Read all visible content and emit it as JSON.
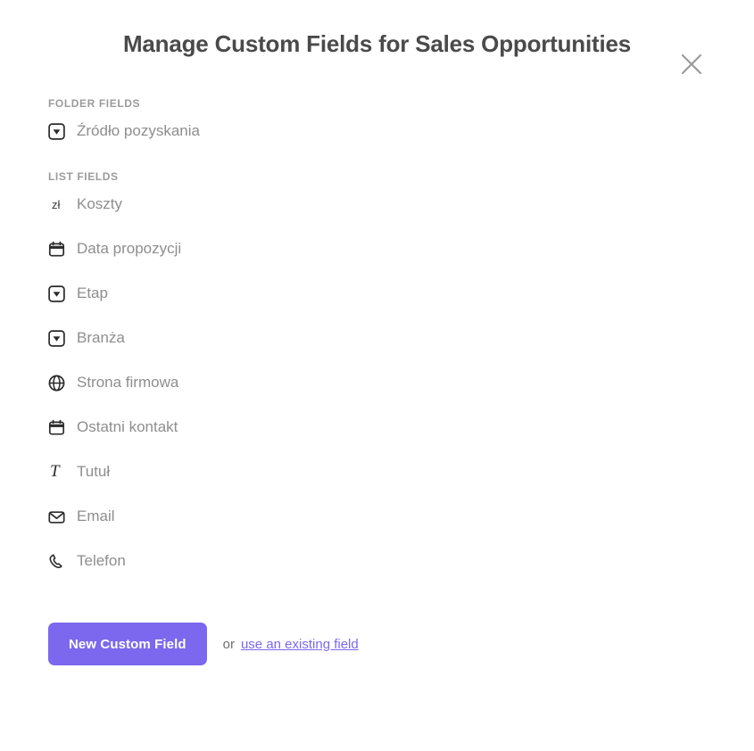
{
  "modal": {
    "title": "Manage Custom Fields for Sales Opportunities",
    "close_icon": "close-icon"
  },
  "sections": [
    {
      "label": "FOLDER FIELDS",
      "fields": [
        {
          "label": "Źródło pozyskania",
          "icon": "dropdown-icon"
        }
      ]
    },
    {
      "label": "LIST FIELDS",
      "fields": [
        {
          "label": "Koszty",
          "icon": "currency-icon",
          "icon_text": "zł"
        },
        {
          "label": "Data propozycji",
          "icon": "calendar-icon"
        },
        {
          "label": "Etap",
          "icon": "dropdown-icon"
        },
        {
          "label": "Branża",
          "icon": "dropdown-icon"
        },
        {
          "label": "Strona firmowa",
          "icon": "globe-icon"
        },
        {
          "label": "Ostatni kontakt",
          "icon": "calendar-icon"
        },
        {
          "label": "Tutuł",
          "icon": "text-icon",
          "icon_text": "T"
        },
        {
          "label": "Email",
          "icon": "envelope-icon"
        },
        {
          "label": "Telefon",
          "icon": "phone-icon"
        }
      ]
    }
  ],
  "footer": {
    "new_field_button": "New Custom Field",
    "or_text": "or",
    "existing_field_link": "use an existing field"
  },
  "colors": {
    "accent": "#7b68ee",
    "title": "#4a4a4a",
    "section_label": "#9b9b9b",
    "field_label": "#8e8e8e",
    "icon": "#2b2b2b"
  }
}
